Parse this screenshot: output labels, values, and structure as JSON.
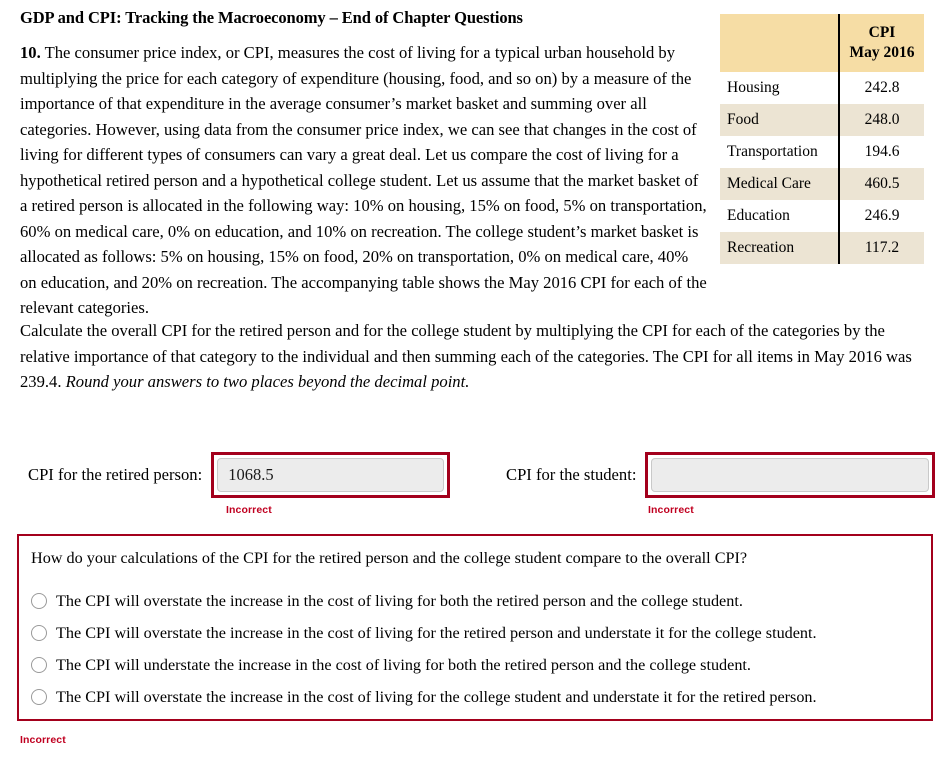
{
  "page": {
    "title": "GDP and CPI: Tracking the Macroeconomy – End of Chapter Questions"
  },
  "question": {
    "number": "10.",
    "body": "The consumer price index, or CPI, measures the cost of living for a typical urban household by multiplying the price for each category of expenditure (housing, food, and so on) by a measure of the importance of that expenditure in the average consumer’s market basket and summing over all categories. However, using data from the consumer price index, we can see that changes in the cost of living for different types of consumers can vary a great deal. Let us compare the cost of living for a hypothetical retired person and a hypothetical college student. Let us assume that the market basket of a retired person is allocated in the following way: 10% on housing, 15% on food, 5% on transportation, 60% on medical care, 0% on education, and 10% on recreation. The college student’s market basket is allocated as follows: 5% on housing, 15% on food, 20% on transportation, 0% on medical care, 40% on education, and 20% on recreation. The accompanying table shows the May 2016 CPI for each of the relevant categories.",
    "instructions_plain": "Calculate the overall CPI for the retired person and for the college student by multiplying the CPI for each of the categories by the relative importance of that category to the individual and then summing each of the categories. The CPI for all items in May 2016 was 239.4. ",
    "instructions_italic": "Round your answers to two places beyond the decimal point."
  },
  "cpi_table": {
    "header": {
      "category_column": "",
      "value_line1": "CPI",
      "value_line2": "May 2016"
    },
    "rows": [
      {
        "category": "Housing",
        "value": "242.8"
      },
      {
        "category": "Food",
        "value": "248.0"
      },
      {
        "category": "Transportation",
        "value": "194.6"
      },
      {
        "category": "Medical Care",
        "value": "460.5"
      },
      {
        "category": "Education",
        "value": "246.9"
      },
      {
        "category": "Recreation",
        "value": "117.2"
      }
    ]
  },
  "answers": {
    "retired": {
      "label": "CPI for the retired person:",
      "value": "1068.5",
      "placeholder": "",
      "feedback": "Incorrect"
    },
    "student": {
      "label": "CPI for the student:",
      "value": "",
      "placeholder": "",
      "feedback": "Incorrect"
    }
  },
  "multiple_choice": {
    "question": "How do your calculations of the CPI for the retired person and the college student compare to the overall CPI?",
    "options": [
      {
        "label": "The CPI will overstate the increase in the cost of living for both the retired person and the college student."
      },
      {
        "label": "The CPI will overstate the increase in the cost of living for the retired person and understate it for the college student."
      },
      {
        "label": "The CPI will understate the increase in the cost of living for both the retired person and the college student."
      },
      {
        "label": "The CPI will overstate the increase in the cost of living for the college student and understate it for the retired person."
      }
    ],
    "feedback": "Incorrect"
  },
  "colors": {
    "error_red": "#a3001c",
    "feedback_red": "#c00020",
    "table_header_tan": "#f6dda5",
    "table_alt_row": "#ece4d3"
  }
}
